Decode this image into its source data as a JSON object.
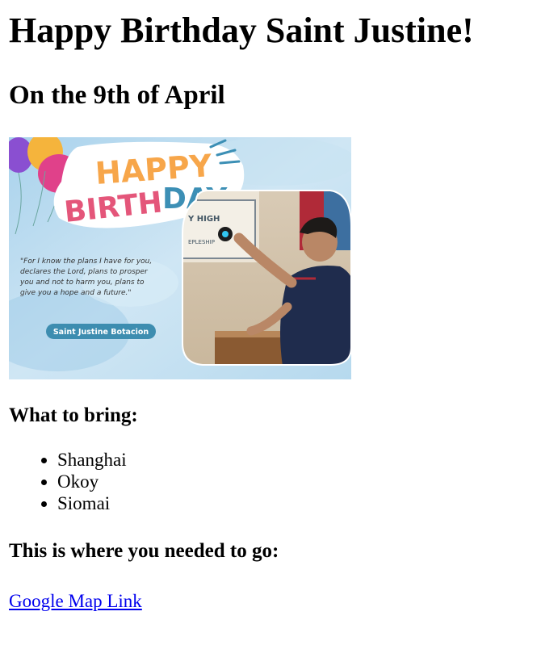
{
  "page": {
    "title": "Happy Birthday Saint Justine!",
    "subtitle": "On the 9th of April"
  },
  "banner": {
    "happy": "HAPPY",
    "birth": "BIRTH",
    "day": "DAY",
    "quote_lines": [
      "\"For I know the plans I have for you,",
      "declares the Lord, plans to prosper",
      "you and not to harm you, plans to",
      "give you a hope and a future.\""
    ],
    "name": "Saint Justine Botacion",
    "colors": {
      "sky": "#bcdcef",
      "happy": "#f7a64a",
      "birth": "#e4567a",
      "day": "#3c8fb5",
      "pill": "#3d8db0",
      "shirt": "#1f2c4d"
    }
  },
  "bring": {
    "heading": "What to bring:",
    "items": [
      "Shanghai",
      "Okoy",
      "Siomai"
    ]
  },
  "location": {
    "heading": "This is where you needed to go:",
    "link_text": "Google Map Link"
  }
}
